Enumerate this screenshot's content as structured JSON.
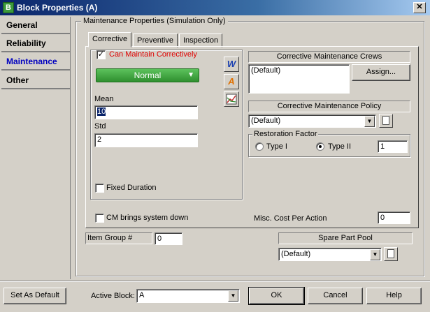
{
  "window": {
    "title": "Block Properties (A)",
    "app_icon_letter": "B",
    "close_glyph": "✕"
  },
  "sidebar": {
    "items": [
      {
        "label": "General"
      },
      {
        "label": "Reliability"
      },
      {
        "label": "Maintenance"
      },
      {
        "label": "Other"
      }
    ]
  },
  "group_title": "Maintenance Properties (Simulation Only)",
  "tabs": [
    {
      "label": "Corrective"
    },
    {
      "label": "Preventive"
    },
    {
      "label": "Inspection"
    }
  ],
  "corrective": {
    "can_maintain_label": "Can Maintain Correctively",
    "can_maintain_checked": "✓",
    "distribution": "Normal",
    "mean_label": "Mean",
    "mean_value": "10",
    "std_label": "Std",
    "std_value": "2",
    "fixed_duration_label": "Fixed Duration",
    "icons": {
      "w": "W",
      "a": "A"
    }
  },
  "crews": {
    "header": "Corrective Maintenance Crews",
    "list": [
      "(Default)"
    ],
    "assign_label": "Assign..."
  },
  "policy": {
    "header": "Corrective Maintenance Policy",
    "value": "(Default)"
  },
  "restoration": {
    "title": "Restoration Factor",
    "type1_label": "Type I",
    "type2_label": "Type II",
    "value": "1"
  },
  "cm_brings_down_label": "CM brings system down",
  "misc_cost": {
    "label": "Misc. Cost Per Action",
    "value": "0"
  },
  "item_group": {
    "label": "Item Group #",
    "value": "0"
  },
  "spare_part": {
    "header": "Spare Part Pool",
    "value": "(Default)"
  },
  "footer": {
    "set_default_label": "Set As Default",
    "active_block_label": "Active Block:",
    "active_block_value": "A",
    "ok_label": "OK",
    "cancel_label": "Cancel",
    "help_label": "Help"
  },
  "colors": {
    "title_start": "#0a246a",
    "green_dropdown": "#3fa33f",
    "required_red": "#e00000",
    "active_nav": "#0000c0"
  }
}
